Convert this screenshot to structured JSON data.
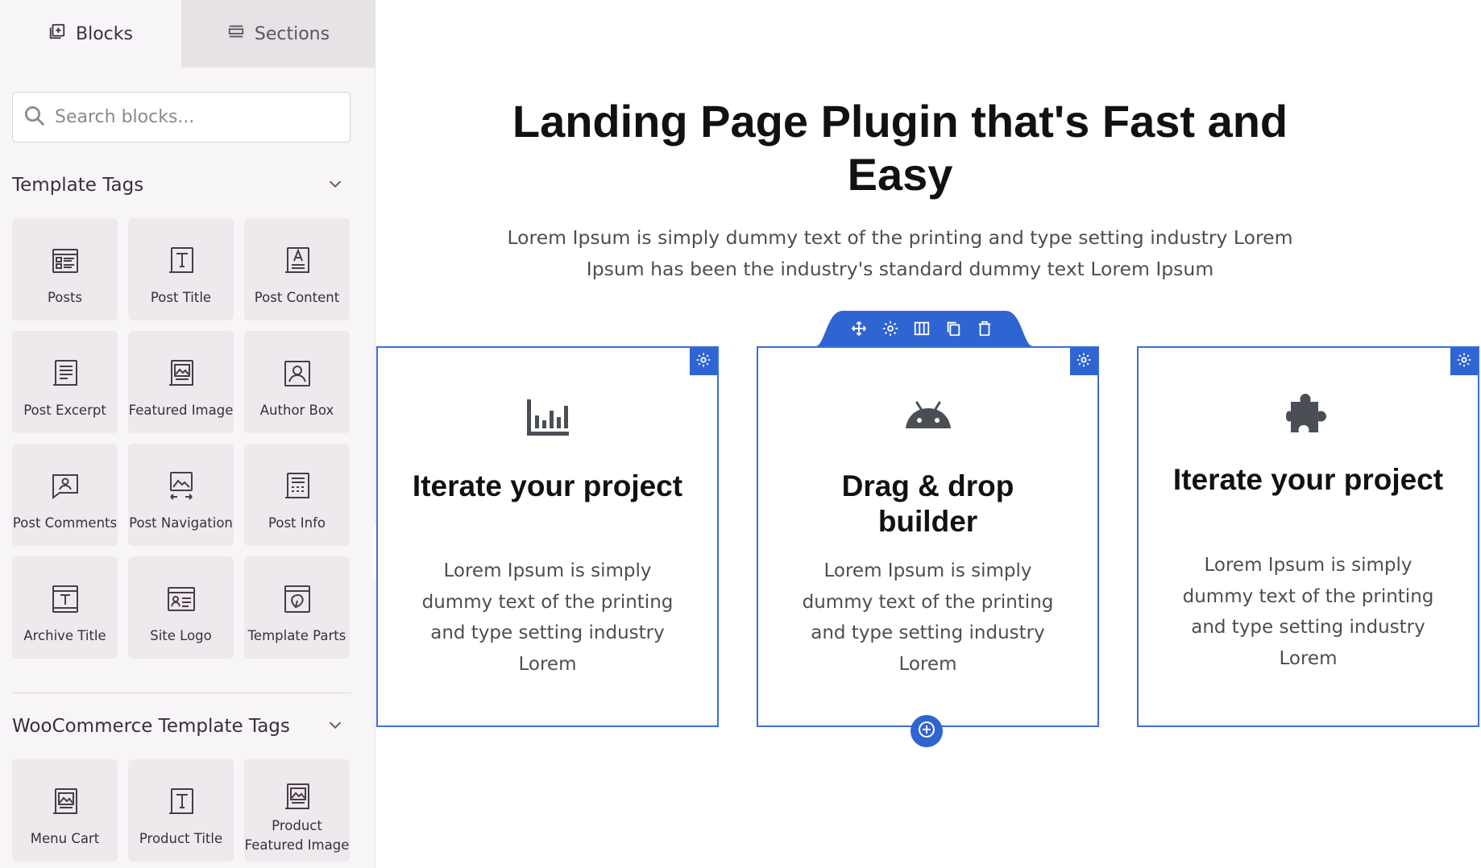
{
  "sidebar": {
    "tabs": [
      {
        "label": "Blocks",
        "icon": "plus-square-icon"
      },
      {
        "label": "Sections",
        "icon": "sections-icon"
      }
    ],
    "search_placeholder": "Search blocks...",
    "categories": [
      {
        "title": "Template Tags",
        "items": [
          {
            "label": "Posts",
            "icon": "posts-icon"
          },
          {
            "label": "Post Title",
            "icon": "post-title-icon"
          },
          {
            "label": "Post Content",
            "icon": "post-content-icon"
          },
          {
            "label": "Post Excerpt",
            "icon": "post-excerpt-icon"
          },
          {
            "label": "Featured Image",
            "icon": "featured-image-icon"
          },
          {
            "label": "Author Box",
            "icon": "author-box-icon"
          },
          {
            "label": "Post Comments",
            "icon": "post-comments-icon"
          },
          {
            "label": "Post Navigation",
            "icon": "post-navigation-icon"
          },
          {
            "label": "Post Info",
            "icon": "post-info-icon"
          },
          {
            "label": "Archive Title",
            "icon": "archive-title-icon"
          },
          {
            "label": "Site Logo",
            "icon": "site-logo-icon"
          },
          {
            "label": "Template Parts",
            "icon": "template-parts-icon"
          }
        ]
      },
      {
        "title": "WooCommerce Template Tags",
        "items": [
          {
            "label": "Menu Cart",
            "icon": "menu-cart-icon"
          },
          {
            "label": "Product Title",
            "icon": "product-title-icon"
          },
          {
            "label": "Product Featured Image",
            "icon": "product-featured-image-icon"
          }
        ]
      }
    ]
  },
  "canvas": {
    "title": "Landing Page Plugin that's Fast and Easy",
    "subtitle": "Lorem Ipsum is simply dummy text of the printing and type setting industry Lorem Ipsum has been the industry's standard dummy text Lorem Ipsum",
    "toolbar": [
      "move-icon",
      "settings-icon",
      "columns-icon",
      "duplicate-icon",
      "delete-icon"
    ],
    "cards": [
      {
        "icon": "bar-chart-icon",
        "title": "Iterate your project",
        "text": "Lorem Ipsum is simply dummy text of the printing and type setting industry Lorem"
      },
      {
        "icon": "android-icon",
        "title": "Drag & drop builder",
        "text": "Lorem Ipsum is simply dummy text of the printing and type setting industry Lorem"
      },
      {
        "icon": "puzzle-icon",
        "title": "Iterate your project",
        "text": "Lorem Ipsum is simply dummy text of the printing and type setting industry Lorem"
      }
    ]
  },
  "colors": {
    "accent": "#2f64d3",
    "card_border": "#3b6fd6",
    "sidebar_bg": "#f7f5f7",
    "tile_bg": "#ede9ed",
    "icon": "#4a3c4a"
  }
}
